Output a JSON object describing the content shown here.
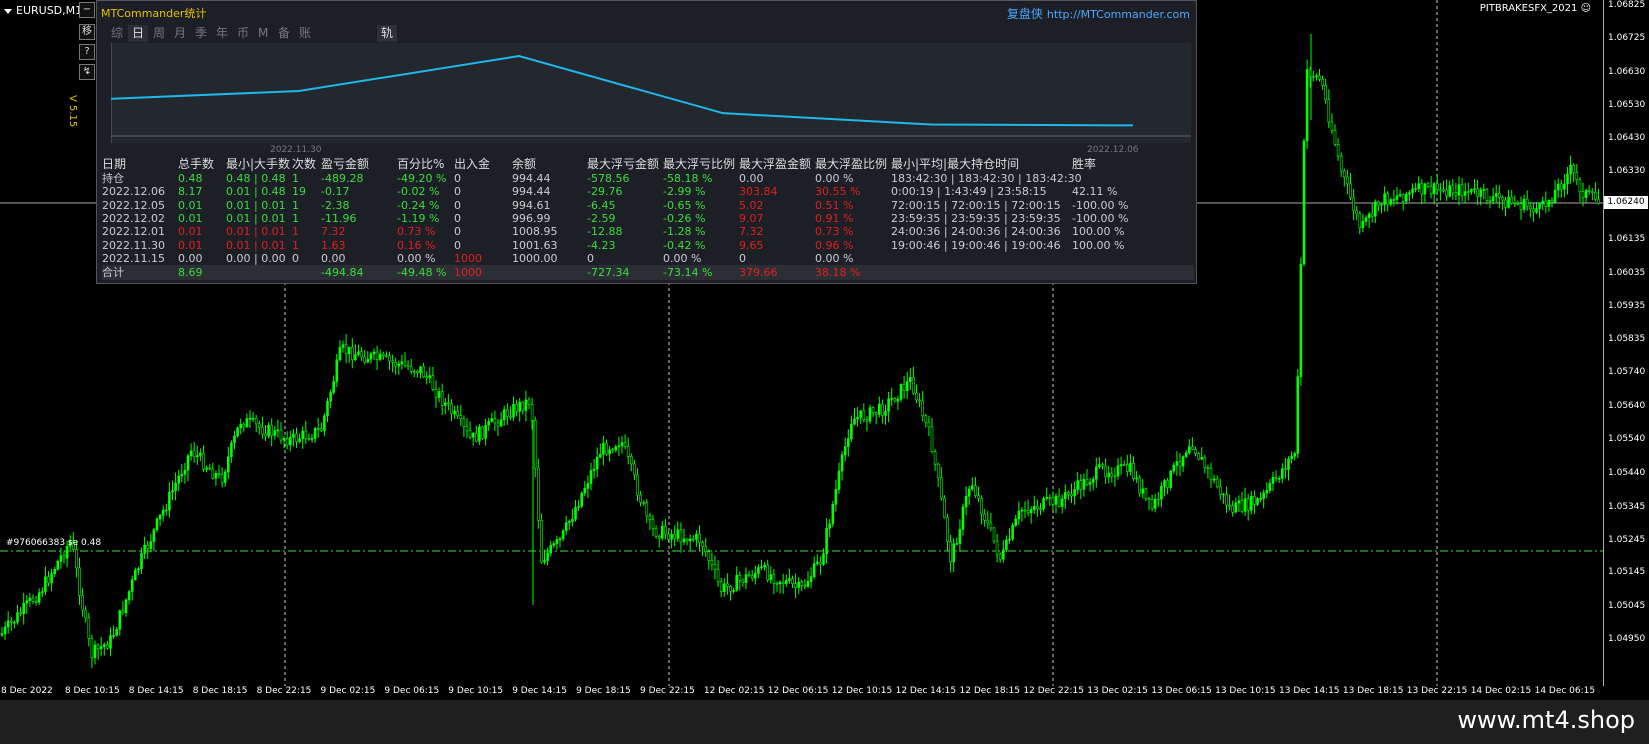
{
  "symbol_label": "EURUSD,M15",
  "indicator_label": "PITBRAKESFX_2021",
  "version": "V 5.15",
  "side_buttons": [
    "移",
    "?",
    "↯"
  ],
  "panel": {
    "title": "MTCommander统计",
    "brand": "复盘侠",
    "link": "http://MTCommander.com",
    "tabs": [
      "综",
      "日",
      "周",
      "月",
      "季",
      "年",
      "币",
      "M",
      "备",
      "账户"
    ],
    "active_tab": "日",
    "track_tab": "轨迹",
    "graph_dates": [
      "2022.11.30",
      "2022.12.06"
    ],
    "headers": [
      "日期",
      "总手数",
      "最小|大手数",
      "次数",
      "盈亏金额",
      "百分比%",
      "出入金",
      "余额",
      "最大浮亏金额",
      "最大浮亏比例",
      "最大浮盈金额",
      "最大浮盈比例",
      "最小|平均|最大持仓时间",
      "胜率"
    ],
    "rows": [
      {
        "cells": [
          "持仓",
          "0.48",
          "0.48 | 0.48",
          "1",
          "-489.28",
          "-49.20 %",
          "0",
          "994.44",
          "-578.56",
          "-58.18 %",
          "0.00",
          "0.00 %",
          "183:42:30 | 183:42:30 | 183:42:30",
          ""
        ],
        "colors": [
          "w",
          "g",
          "g",
          "g",
          "g",
          "g",
          "w",
          "w",
          "g",
          "g",
          "w",
          "w",
          "w",
          "w"
        ]
      },
      {
        "cells": [
          "2022.12.06",
          "8.17",
          "0.01 | 0.48",
          "19",
          "-0.17",
          "-0.02 %",
          "0",
          "994.44",
          "-29.76",
          "-2.99 %",
          "303.84",
          "30.55 %",
          "0:00:19 | 1:43:49 | 23:58:15",
          "42.11 %"
        ],
        "colors": [
          "w",
          "g",
          "g",
          "g",
          "g",
          "g",
          "w",
          "w",
          "g",
          "g",
          "r",
          "r",
          "w",
          "w"
        ]
      },
      {
        "cells": [
          "2022.12.05",
          "0.01",
          "0.01 | 0.01",
          "1",
          "-2.38",
          "-0.24 %",
          "0",
          "994.61",
          "-6.45",
          "-0.65 %",
          "5.02",
          "0.51 %",
          "72:00:15 | 72:00:15 | 72:00:15",
          "-100.00 %"
        ],
        "colors": [
          "w",
          "g",
          "g",
          "g",
          "g",
          "g",
          "w",
          "w",
          "g",
          "g",
          "r",
          "r",
          "w",
          "w"
        ]
      },
      {
        "cells": [
          "2022.12.02",
          "0.01",
          "0.01 | 0.01",
          "1",
          "-11.96",
          "-1.19 %",
          "0",
          "996.99",
          "-2.59",
          "-0.26 %",
          "9.07",
          "0.91 %",
          "23:59:35 | 23:59:35 | 23:59:35",
          "-100.00 %"
        ],
        "colors": [
          "w",
          "g",
          "g",
          "g",
          "g",
          "g",
          "w",
          "w",
          "g",
          "g",
          "r",
          "r",
          "w",
          "w"
        ]
      },
      {
        "cells": [
          "2022.12.01",
          "0.01",
          "0.01 | 0.01",
          "1",
          "7.32",
          "0.73 %",
          "0",
          "1008.95",
          "-12.88",
          "-1.28 %",
          "7.32",
          "0.73 %",
          "24:00:36 | 24:00:36 | 24:00:36",
          "100.00 %"
        ],
        "colors": [
          "w",
          "r",
          "r",
          "r",
          "r",
          "r",
          "w",
          "w",
          "g",
          "g",
          "r",
          "r",
          "w",
          "w"
        ]
      },
      {
        "cells": [
          "2022.11.30",
          "0.01",
          "0.01 | 0.01",
          "1",
          "1.63",
          "0.16 %",
          "0",
          "1001.63",
          "-4.23",
          "-0.42 %",
          "9.65",
          "0.96 %",
          "19:00:46 | 19:00:46 | 19:00:46",
          "100.00 %"
        ],
        "colors": [
          "w",
          "r",
          "r",
          "r",
          "r",
          "r",
          "w",
          "w",
          "g",
          "g",
          "r",
          "r",
          "w",
          "w"
        ]
      },
      {
        "cells": [
          "2022.11.15",
          "0.00",
          "0.00 | 0.00",
          "0",
          "0.00",
          "0.00 %",
          "1000",
          "1000.00",
          "0",
          "0.00 %",
          "0",
          "0.00 %",
          "",
          ""
        ],
        "colors": [
          "w",
          "w",
          "w",
          "w",
          "w",
          "w",
          "r",
          "w",
          "w",
          "w",
          "w",
          "w",
          "w",
          "w"
        ]
      }
    ],
    "total": {
      "cells": [
        "合计",
        "8.69",
        "",
        "",
        "-494.84",
        "-49.48 %",
        "1000",
        "",
        "-727.34",
        "-73.14 %",
        "379.66",
        "38.18 %",
        "",
        ""
      ],
      "colors": [
        "w",
        "g",
        "w",
        "w",
        "g",
        "g",
        "r",
        "w",
        "g",
        "g",
        "r",
        "r",
        "w",
        "w"
      ]
    },
    "equity_curve": [
      {
        "date": "2022.11.15",
        "balance": 1000.0
      },
      {
        "date": "2022.11.30",
        "balance": 1001.63
      },
      {
        "date": "2022.12.01",
        "balance": 1008.95
      },
      {
        "date": "2022.12.02",
        "balance": 996.99
      },
      {
        "date": "2022.12.05",
        "balance": 994.61
      },
      {
        "date": "2022.12.06",
        "balance": 994.44
      },
      {
        "date": "持仓",
        "balance": 994.44
      }
    ]
  },
  "price_axis": [
    "1.06825",
    "1.06725",
    "1.06630",
    "1.06530",
    "1.06430",
    "1.06330",
    "1.06240",
    "1.06135",
    "1.06035",
    "1.05935",
    "1.05835",
    "1.05740",
    "1.05640",
    "1.05540",
    "1.05440",
    "1.05345",
    "1.05245",
    "1.05145",
    "1.05045",
    "1.04950"
  ],
  "current_price": "1.06240",
  "order_label": "#976066383 se 0.48",
  "time_axis": [
    "8 Dec 2022",
    "8 Dec 10:15",
    "8 Dec 14:15",
    "8 Dec 18:15",
    "8 Dec 22:15",
    "9 Dec 02:15",
    "9 Dec 06:15",
    "9 Dec 10:15",
    "9 Dec 14:15",
    "9 Dec 18:15",
    "9 Dec 22:15",
    "12 Dec 02:15",
    "12 Dec 06:15",
    "12 Dec 10:15",
    "12 Dec 14:15",
    "12 Dec 18:15",
    "12 Dec 22:15",
    "13 Dec 02:15",
    "13 Dec 06:15",
    "13 Dec 10:15",
    "13 Dec 14:15",
    "13 Dec 18:15",
    "13 Dec 22:15",
    "14 Dec 02:15",
    "14 Dec 06:15"
  ],
  "watermark": "www.mt4.shop",
  "colors": {
    "bull": "#00ff00",
    "bear": "#3ddc3d",
    "curve": "#1fb8ea",
    "order_line": "#3ddc3d"
  }
}
